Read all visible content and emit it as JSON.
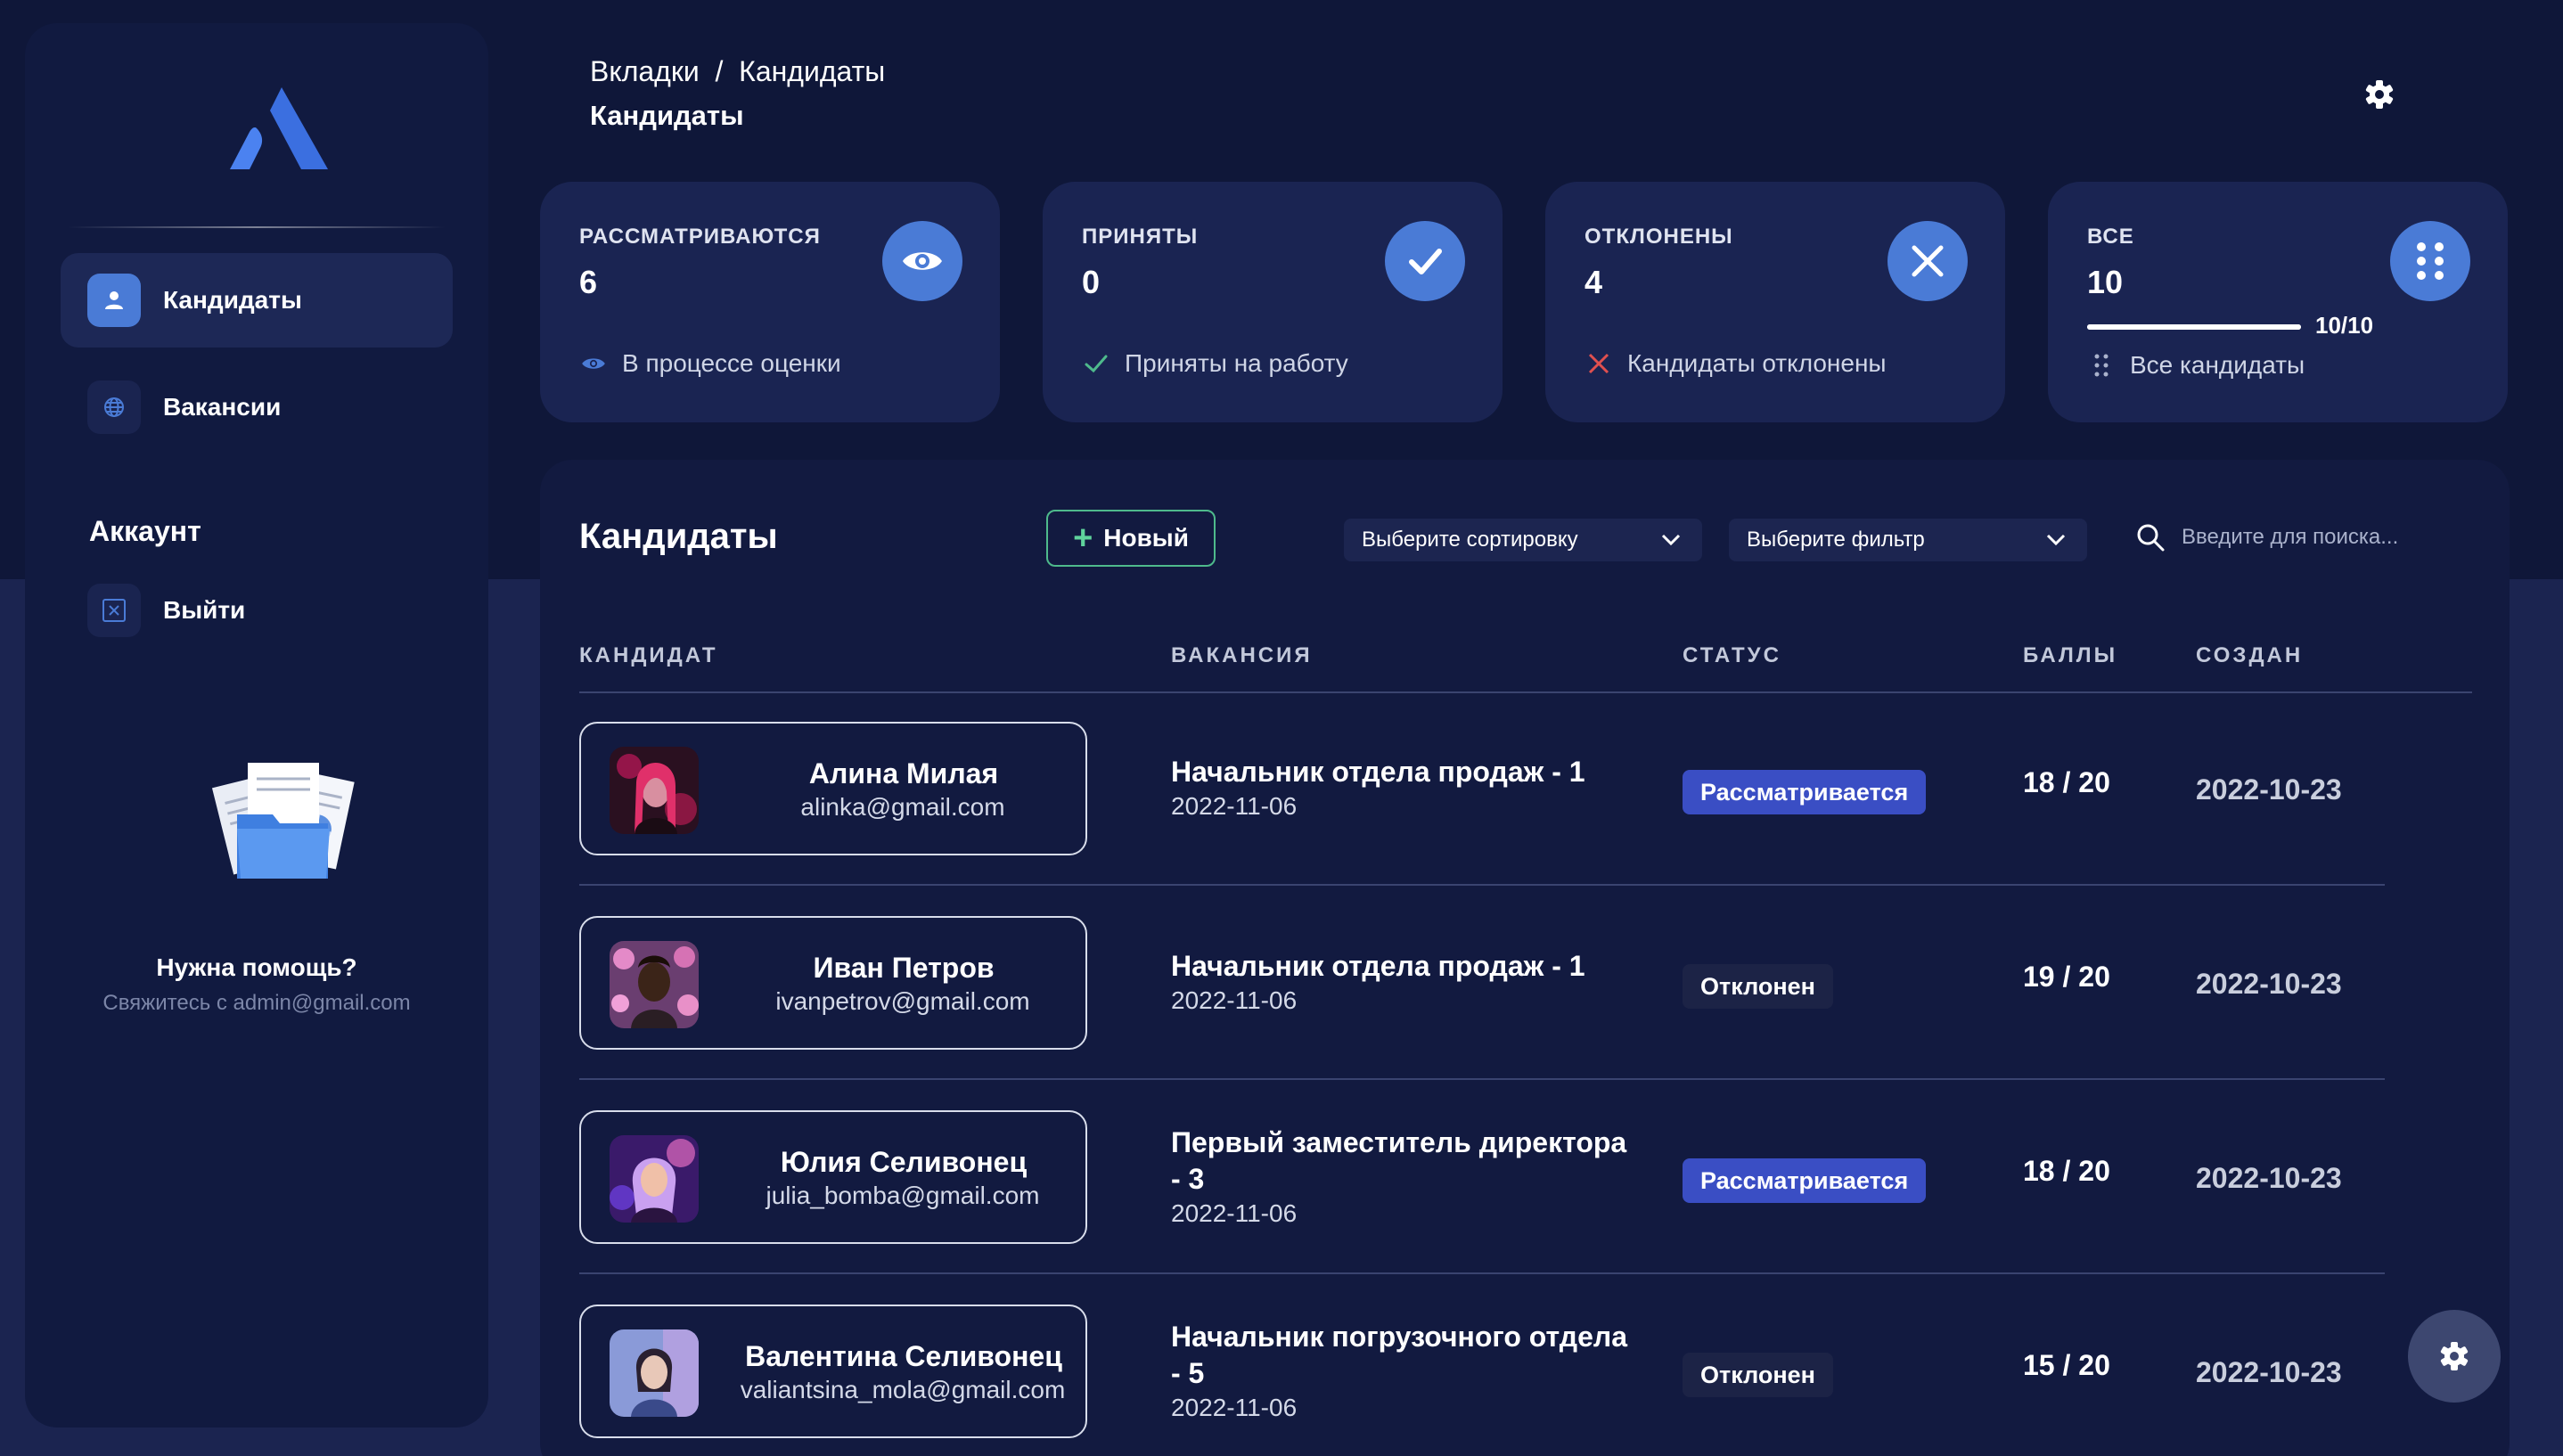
{
  "sidebar": {
    "logo_icon": "atlassian-logo-icon",
    "items": [
      {
        "label": "Кандидаты",
        "icon": "user-icon",
        "active": true
      },
      {
        "label": "Вакансии",
        "icon": "globe-icon",
        "active": false
      }
    ],
    "section_label": "Аккаунт",
    "logout_label": "Выйти",
    "help_title": "Нужна помощь?",
    "help_subtitle": "Свяжитесь с admin@gmail.com"
  },
  "header": {
    "breadcrumb_root": "Вкладки",
    "breadcrumb_separator": "/",
    "breadcrumb_current": "Кандидаты",
    "page_title": "Кандидаты"
  },
  "stats": [
    {
      "title": "РАССМАТРИВАЮТСЯ",
      "value": "6",
      "footer": "В процессе оценки",
      "icon": "eye-icon"
    },
    {
      "title": "ПРИНЯТЫ",
      "value": "0",
      "footer": "Приняты на работу",
      "icon": "check-icon"
    },
    {
      "title": "ОТКЛОНЕНЫ",
      "value": "4",
      "footer": "Кандидаты отклонены",
      "icon": "close-icon"
    },
    {
      "title": "ВСЕ",
      "value": "10",
      "progress_label": "10/10",
      "progress_fraction": 1.0,
      "footer": "Все кандидаты",
      "icon": "grid-dots-icon"
    }
  ],
  "table": {
    "title": "Кандидаты",
    "new_button": "Новый",
    "sort_placeholder": "Выберите сортировку",
    "filter_placeholder": "Выберите фильтр",
    "search_placeholder": "Введите для поиска...",
    "columns": [
      "КАНДИДАТ",
      "ВАКАНСИЯ",
      "СТАТУС",
      "БАЛЛЫ",
      "СОЗДАН"
    ],
    "rows": [
      {
        "name": "Алина Милая",
        "email": "alinka@gmail.com",
        "vacancy": "Начальник отдела продаж - 1",
        "vacancy_date": "2022-11-06",
        "status": "Рассматривается",
        "status_type": "review",
        "score": "18 / 20",
        "created": "2022-10-23"
      },
      {
        "name": "Иван Петров",
        "email": "ivanpetrov@gmail.com",
        "vacancy": "Начальник отдела продаж - 1",
        "vacancy_date": "2022-11-06",
        "status": "Отклонен",
        "status_type": "rejected",
        "score": "19 / 20",
        "created": "2022-10-23"
      },
      {
        "name": "Юлия Селивонец",
        "email": "julia_bomba@gmail.com",
        "vacancy": "Первый заместитель директора - 3",
        "vacancy_date": "2022-11-06",
        "status": "Рассматривается",
        "status_type": "review",
        "score": "18 / 20",
        "created": "2022-10-23"
      },
      {
        "name": "Валентина Селивонец",
        "email": "valiantsina_mola@gmail.com",
        "vacancy": "Начальник погрузочного отдела - 5",
        "vacancy_date": "2022-11-06",
        "status": "Отклонен",
        "status_type": "rejected",
        "score": "15 / 20",
        "created": "2022-10-23"
      }
    ]
  },
  "colors": {
    "accent": "#4a7bd6",
    "badge_review": "#3a4ec4",
    "badge_rejected": "#1c2346",
    "new_button_border": "#4eba8c"
  }
}
